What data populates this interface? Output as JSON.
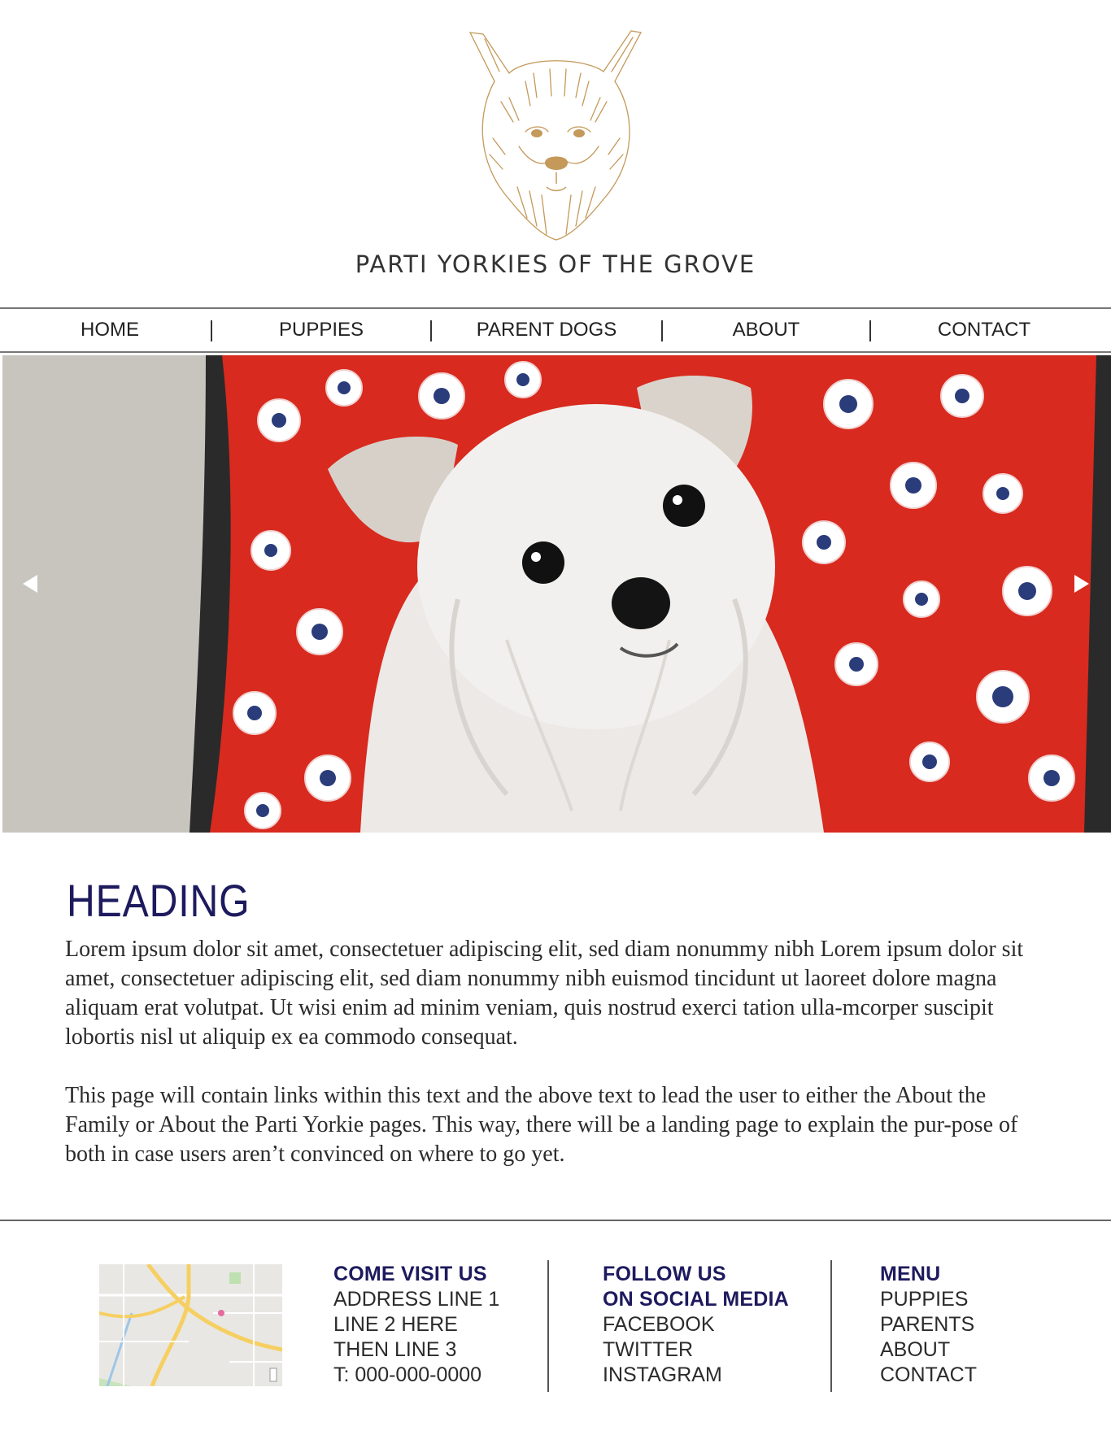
{
  "brand": {
    "title": "PARTI YORKIES OF THE GROVE",
    "logo_icon": "yorkie-head-icon",
    "logo_color": "#c4995a"
  },
  "nav": {
    "items": [
      {
        "label": "HOME"
      },
      {
        "label": "PUPPIES"
      },
      {
        "label": "PARENT DOGS"
      },
      {
        "label": "ABOUT"
      },
      {
        "label": "CONTACT"
      }
    ],
    "separator": "|"
  },
  "hero": {
    "prev_icon": "chevron-left-icon",
    "next_icon": "chevron-right-icon"
  },
  "content": {
    "heading": "HEADING",
    "paragraph1": "Lorem ipsum dolor sit amet, consectetuer adipiscing elit, sed diam nonummy nibh Lorem ipsum dolor sit amet, consectetuer adipiscing elit, sed diam nonummy nibh euismod tincidunt ut laoreet dolore magna aliquam erat volutpat. Ut wisi enim ad minim veniam, quis nostrud exerci tation ulla-mcorper suscipit lobortis nisl ut aliquip ex ea commodo consequat.",
    "paragraph2": "This page will contain links within this text and the above text to lead the user to either the About the Family or About the Parti Yorkie pages. This way, there will be a landing page to explain the pur-pose of both in case users aren’t convinced on where to go yet."
  },
  "footer": {
    "visit": {
      "title": "COME VISIT US",
      "lines": [
        "ADDRESS LINE 1",
        "LINE 2 HERE",
        "THEN LINE 3",
        "T: 000-000-0000"
      ]
    },
    "social": {
      "title_line1": "FOLLOW US",
      "title_line2": "ON SOCIAL MEDIA",
      "links": [
        "FACEBOOK",
        "TWITTER",
        "INSTAGRAM"
      ]
    },
    "menu": {
      "title": "MENU",
      "links": [
        "PUPPIES",
        "PARENTS",
        "ABOUT",
        "CONTACT"
      ]
    }
  },
  "colors": {
    "accent_navy": "#1d1a5e",
    "logo_gold": "#c4995a",
    "rule_gray": "#777777"
  }
}
